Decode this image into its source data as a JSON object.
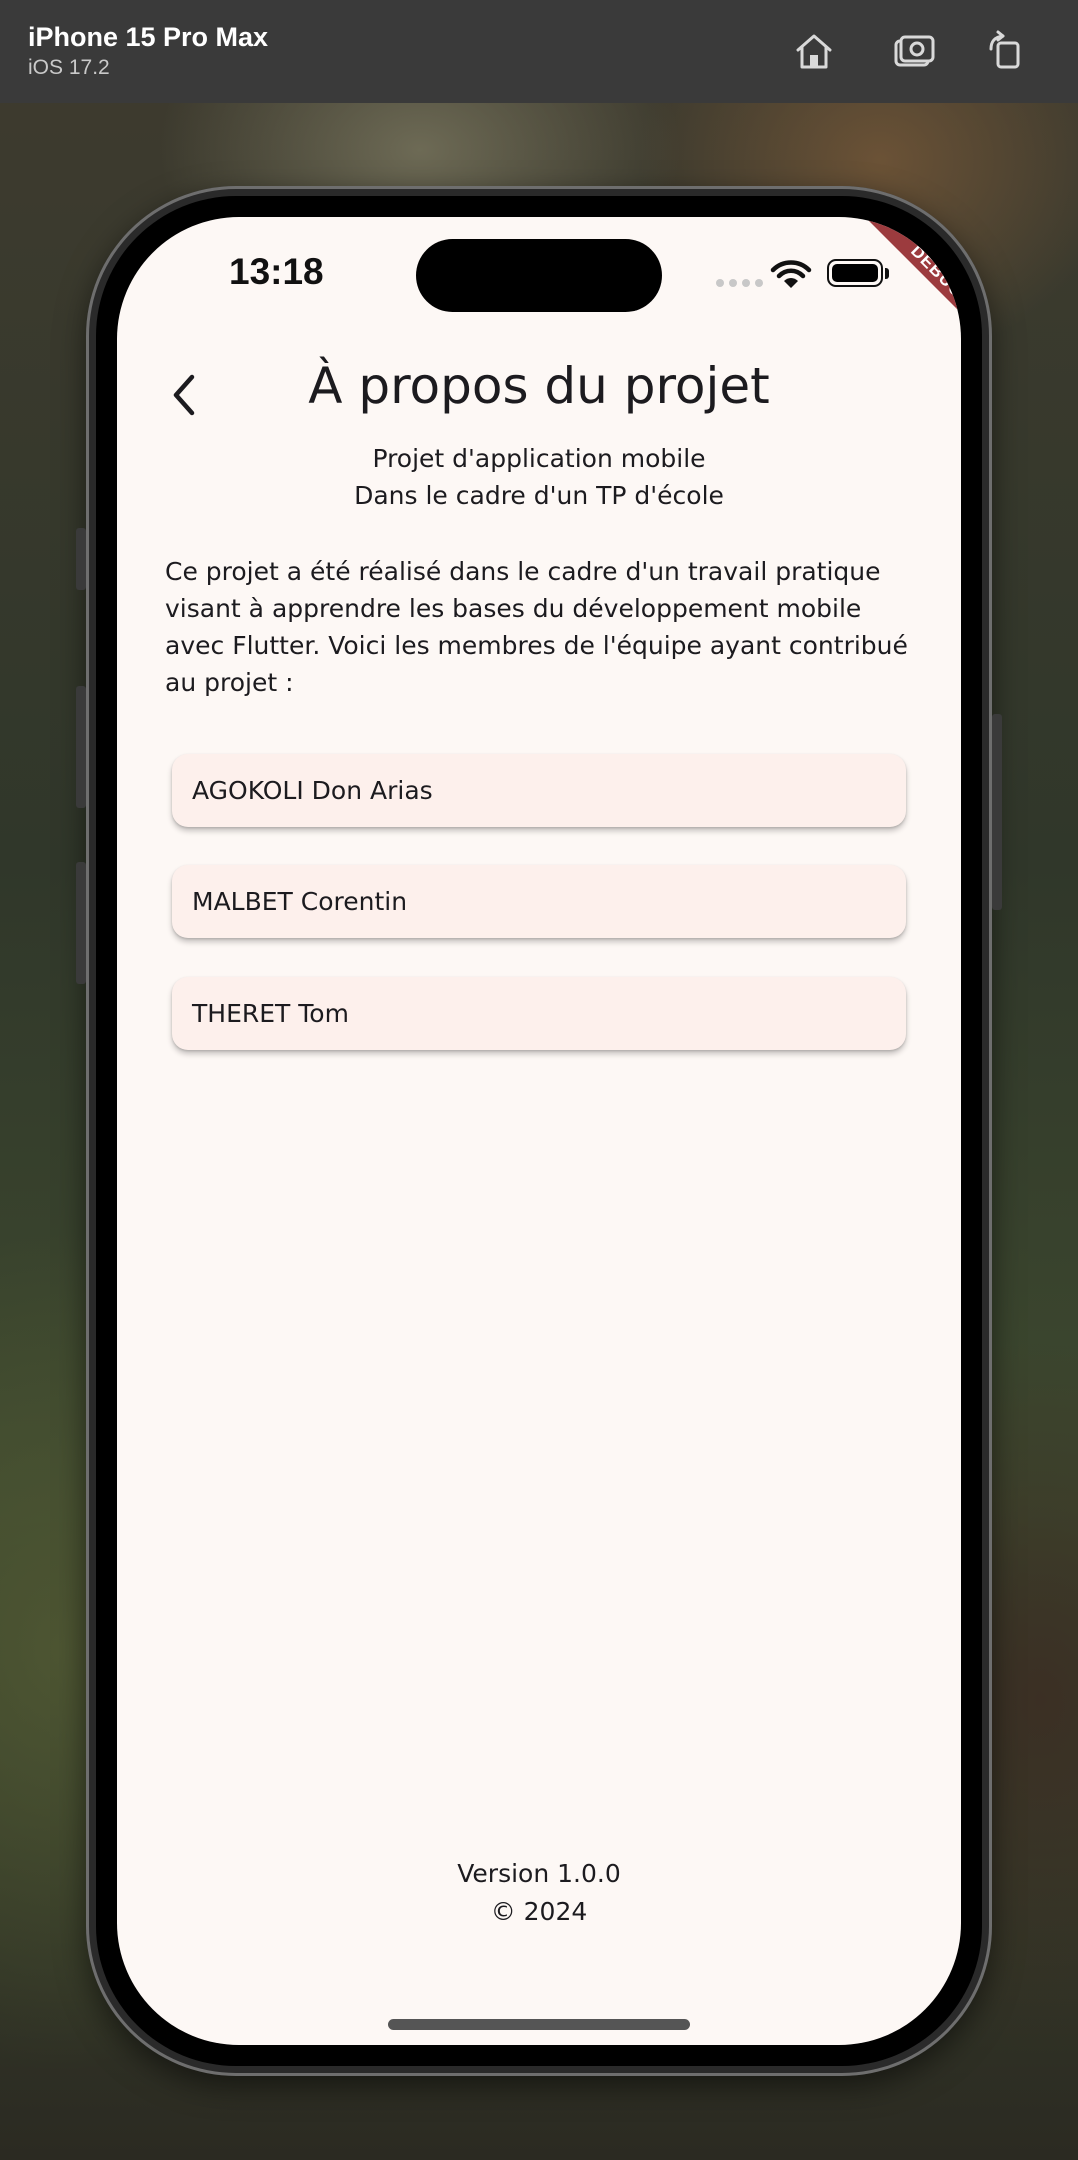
{
  "simulator": {
    "device_name": "iPhone 15 Pro Max",
    "os_version": "iOS 17.2",
    "home_button": "home-icon",
    "screenshot_button": "camera-icon",
    "rotate_button": "rotate-icon"
  },
  "status_bar": {
    "time": "13:18"
  },
  "debug_banner": "DEBUG",
  "app_bar": {
    "title": "À propos du projet",
    "back_icon": "chevron-left-icon"
  },
  "subtitle": {
    "line1": "Projet d'application mobile",
    "line2": "Dans le cadre d'un TP d'école"
  },
  "description": "Ce projet a été réalisé dans le cadre d'un travail pratique visant à apprendre les bases du développement mobile avec Flutter. Voici les membres de l'équipe ayant contribué au projet :",
  "members": [
    {
      "name": "AGOKOLI Don Arias"
    },
    {
      "name": "MALBET Corentin"
    },
    {
      "name": "THERET Tom"
    }
  ],
  "footer": {
    "version": "Version 1.0.0",
    "copyright": "© 2024"
  },
  "colors": {
    "background": "#fdf8f5",
    "card": "#fdf0ec",
    "debug_ribbon": "#9c3b3e",
    "text": "#1c1b1f"
  }
}
